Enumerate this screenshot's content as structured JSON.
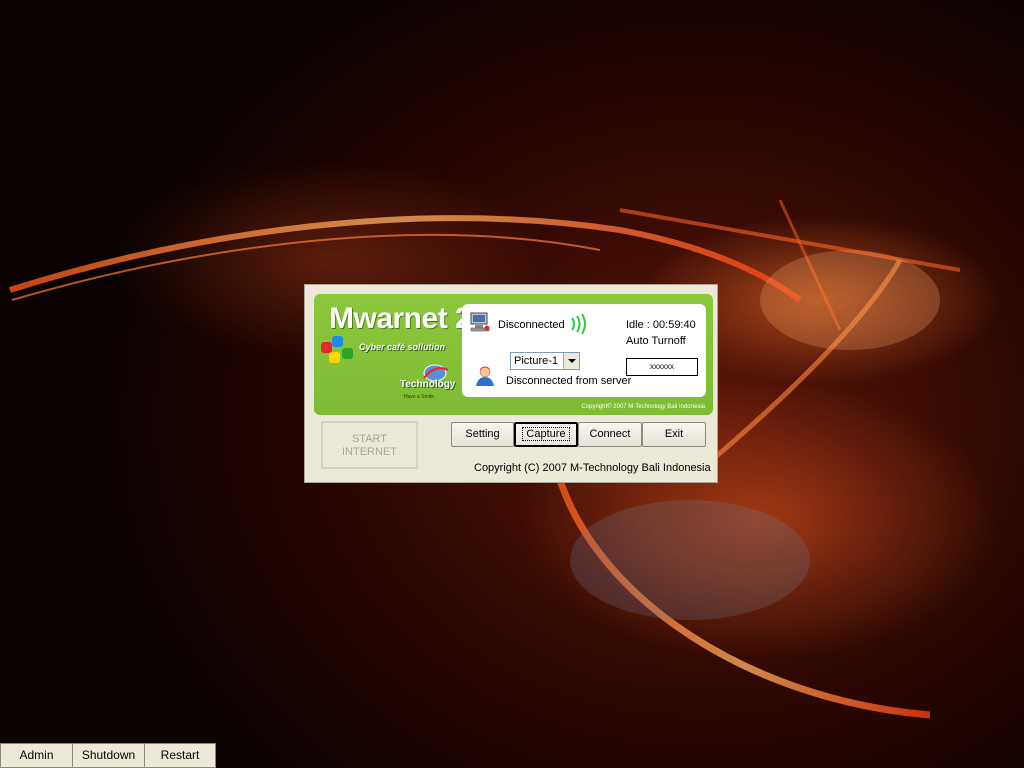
{
  "app": {
    "brand_title": "Mwarnet 2",
    "brand_subtitle": "Cyber café sollution",
    "tech_logo_text": "Technology",
    "tech_tagline": "Have a Smile",
    "panel_copyright": "Copyright© 2007 M-Technology Bali Indonesia"
  },
  "status": {
    "connection": "Disconnected",
    "idle": "Idle : 00:59:40",
    "auto_turnoff_label": "Auto Turnoff",
    "password_mask": "xxxxxx",
    "picture_select_value": "Picture-1",
    "server_status": "Disconnected from server"
  },
  "buttons": {
    "start_internet_line1": "START",
    "start_internet_line2": "INTERNET",
    "setting": "Setting",
    "capture": "Capture",
    "connect": "Connect",
    "exit": "Exit"
  },
  "footer": {
    "copyright": "Copyright (C) 2007 M-Technology Bali Indonesia"
  },
  "taskbar": {
    "admin": "Admin",
    "shutdown": "Shutdown",
    "restart": "Restart"
  },
  "colors": {
    "panel_green": "#8cc83c",
    "window_bg": "#ece9d8",
    "wifi_green": "#2ecc40"
  },
  "icons": [
    "computer-icon",
    "wifi-signal-icon",
    "user-icon",
    "color-squares-logo",
    "chevron-down-icon"
  ]
}
